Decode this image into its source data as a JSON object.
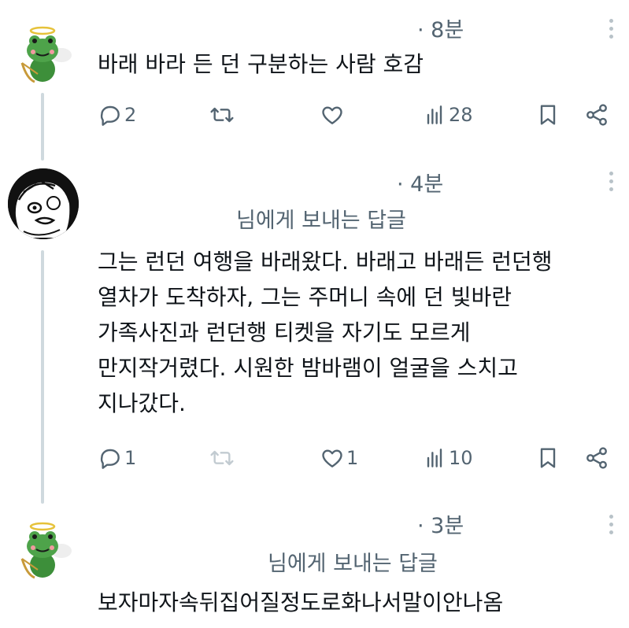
{
  "tweets": [
    {
      "time": "· 8분",
      "text_lines": [
        "바래 바라 든 던 구분하는 사람 호감"
      ],
      "replies": "2",
      "retweets": "",
      "likes": "",
      "views": "28"
    },
    {
      "time": "· 4분",
      "replying_to": "님에게 보내는 답글",
      "text_lines": [
        "그는 런던 여행을 바래왔다. 바래고 바래든 런던행",
        "열차가 도착하자, 그는 주머니 속에 던 빛바란",
        "가족사진과 런던행 티켓을 자기도 모르게",
        "만지작거렸다. 시원한 밤바램이 얼굴을 스치고",
        "지나갔다."
      ],
      "replies": "1",
      "retweets": "",
      "likes": "1",
      "views": "10"
    },
    {
      "time": "· 3분",
      "replying_to": "님에게 보내는 답글",
      "text_lines": [
        "보자마자속뒤집어질정도로화나서말이안나옴"
      ]
    }
  ],
  "icons": {
    "reply": "reply-bubble-icon",
    "retweet": "retweet-icon",
    "like": "heart-icon",
    "views": "views-bar-chart-icon",
    "bookmark": "bookmark-icon",
    "share": "share-icon",
    "more": "more-vertical-icon"
  },
  "colors": {
    "text": "#0f1419",
    "secondary": "#536471",
    "thread_line": "#cfd9de",
    "frog_green": "#3d8f3a"
  }
}
